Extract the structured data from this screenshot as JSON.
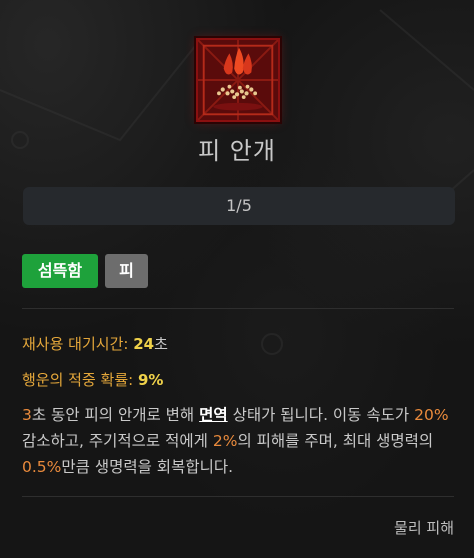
{
  "skill": {
    "name": "피 안개",
    "icon": "blood-mist-icon",
    "level": "1/5"
  },
  "tags": [
    "섬뜩함",
    "피"
  ],
  "stats": {
    "cooldown_label": "재사용 대기시간:",
    "cooldown_value": "24",
    "cooldown_unit": "초",
    "lucky_hit_label": "행운의 적중 확률:",
    "lucky_hit_value": "9%"
  },
  "description": {
    "p1": "3",
    "p2": "초 동안 피의 안개로 변해 ",
    "p3": "면역",
    "p4": " 상태가 됩니다. 이동 속도가 ",
    "p5": "20%",
    "p6": " 감소하고, 주기적으로 적에게 ",
    "p7": "2%",
    "p8": "의 피해를 주며, 최대 생명력의 ",
    "p9": "0.5%",
    "p10": "만큼 생명력을 회복합니다."
  },
  "damage_type": "물리 피해",
  "colors": {
    "background": "#151515",
    "tag_green": "#1ea23b",
    "tag_gray": "#6d6d6d",
    "stat_label": "#e3a63a",
    "stat_value": "#f0d24a",
    "number_highlight": "#e98a3c"
  }
}
